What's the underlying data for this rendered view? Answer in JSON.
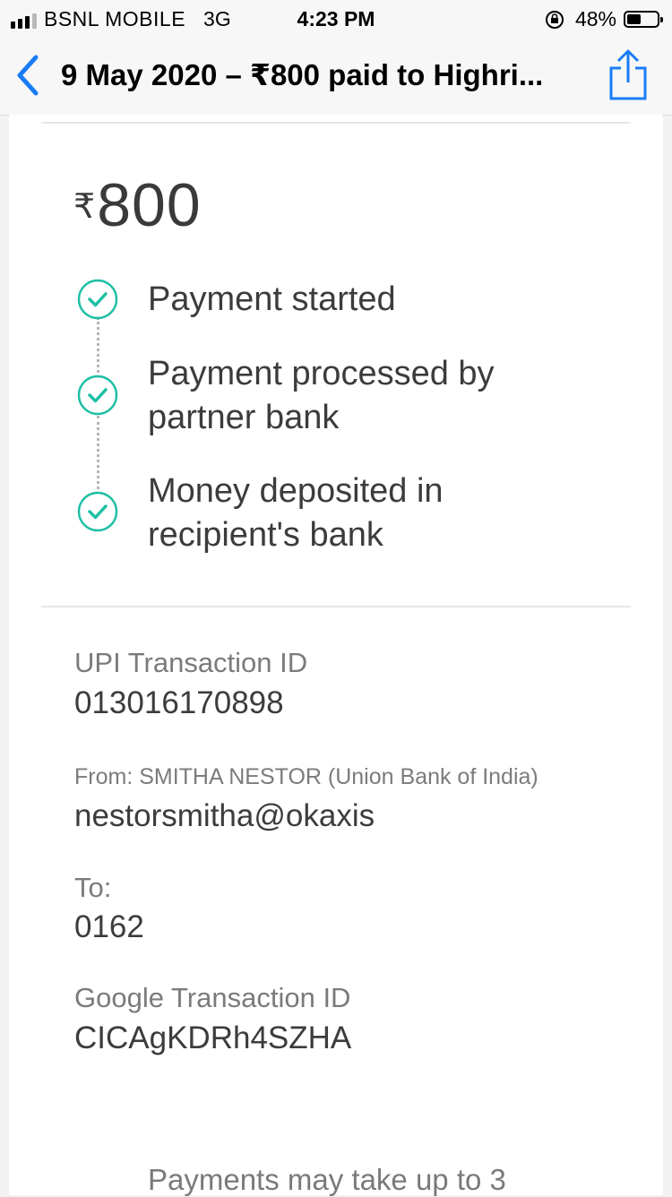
{
  "status_bar": {
    "carrier": "BSNL MOBILE",
    "network": "3G",
    "time": "4:23 PM",
    "battery": "48%",
    "battery_level": 0.48
  },
  "nav": {
    "title": "9 May 2020 – ₹800 paid to Highri...",
    "back_icon": "chevron-left-icon",
    "share_icon": "share-icon",
    "accent_color": "#1a7cf5"
  },
  "payment": {
    "currency_symbol": "₹",
    "amount": "800",
    "check_color": "#1ebfa5",
    "steps": [
      {
        "line1": "Payment started",
        "line2": ""
      },
      {
        "line1": "Payment processed by",
        "line2": "partner bank"
      },
      {
        "line1": "Money deposited in",
        "line2": "recipient's bank"
      }
    ]
  },
  "details": {
    "upi_label": "UPI Transaction ID",
    "upi_value": "013016170898",
    "from_label": "From: SMITHA NESTOR (Union Bank of India)",
    "from_value": "nestorsmitha@okaxis",
    "to_label": "To:",
    "to_value": "0162",
    "google_label": "Google Transaction ID",
    "google_value": "CICAgKDRh4SZHA"
  },
  "footer": {
    "note": "Payments may take up to 3"
  }
}
